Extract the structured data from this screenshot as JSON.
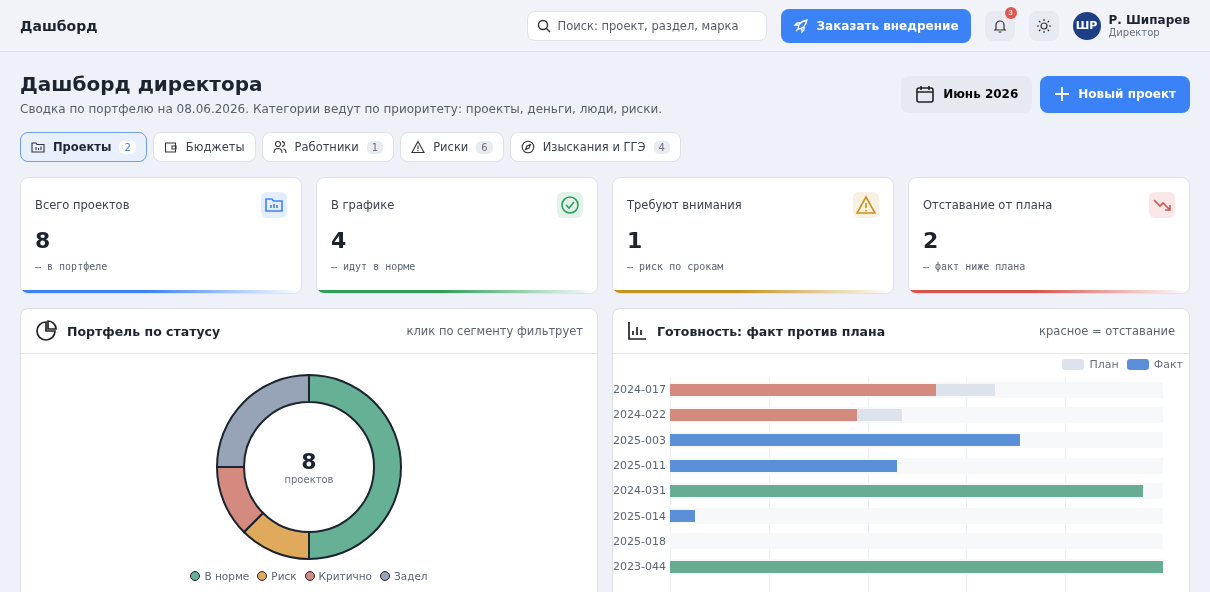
{
  "header": {
    "title": "Дашборд",
    "search": {
      "placeholder": "Поиск: проект, раздел, марка"
    },
    "order_button": "Заказать внедрение",
    "notifications": {
      "count": "3"
    },
    "user": {
      "initials": "ШР",
      "name": "Р. Шипарев",
      "role": "Директор"
    }
  },
  "page": {
    "title": "Дашборд директора",
    "subtitle": "Сводка по портфелю на 08.06.2026. Категории ведут по приоритету: проекты, деньги, люди, риски.",
    "period_button": "Июнь 2026",
    "new_button": "Новый проект"
  },
  "tabs": [
    {
      "kind": "folder",
      "label": "Проекты",
      "count": "2",
      "selected": true
    },
    {
      "kind": "wallet",
      "label": "Бюджеты",
      "selected": false
    },
    {
      "kind": "people",
      "label": "Работники",
      "count": "1",
      "selected": false
    },
    {
      "kind": "warning",
      "label": "Риски",
      "count": "6",
      "selected": false
    },
    {
      "kind": "compass",
      "label": "Изыскания и ГГЭ",
      "count": "4",
      "selected": false
    }
  ],
  "stats": [
    {
      "kind": "folder",
      "title": "Всего проектов",
      "value": "8",
      "note": "— в портфеле",
      "color": "#3b82f6"
    },
    {
      "kind": "check",
      "title": "В графике",
      "value": "4",
      "note": "— идут в норме",
      "color": "#2f9e5b"
    },
    {
      "kind": "warning",
      "title": "Требуют внимания",
      "value": "1",
      "note": "— риск по срокам",
      "color": "#c8921e"
    },
    {
      "kind": "trend",
      "title": "Отставание от плана",
      "value": "2",
      "note": "— факт ниже плана",
      "color": "#d9534f"
    }
  ],
  "status_panel": {
    "title": "Портфель по статусу",
    "hint": "клик по сегменту фильтрует",
    "center_value": "8",
    "center_label": "проектов",
    "chart_data": {
      "type": "donut",
      "categories": [
        "В норме",
        "Риск",
        "Критично",
        "Задел"
      ],
      "values": [
        50,
        12.5,
        12.5,
        25
      ],
      "colors": [
        "#66b096",
        "#e0aa5c",
        "#d58a80",
        "#97a4b8"
      ],
      "legend": "bottom"
    }
  },
  "progress_panel": {
    "title": "Готовность: факт против плана",
    "hint": "красное = отставание",
    "legend": [
      {
        "label": "План",
        "color": "#dde3ec"
      },
      {
        "label": "Факт",
        "color": "#5b8fd8"
      }
    ],
    "rows": [
      {
        "label": "2024-017",
        "plan": {
          "level": 0.66
        },
        "fact": {
          "level": 0.54
        },
        "color": "#d58a80"
      },
      {
        "label": "2024-022",
        "plan": {
          "level": 0.47
        },
        "fact": {
          "level": 0.38
        },
        "color": "#d58a80"
      },
      {
        "label": "2025-003",
        "fact": {
          "level": 0.71
        },
        "color": "#5b8fd8"
      },
      {
        "label": "2025-011",
        "fact": {
          "level": 0.46
        },
        "color": "#5b8fd8"
      },
      {
        "label": "2024-031",
        "fact": {
          "level": 0.96
        },
        "color": "#66ad93"
      },
      {
        "label": "2025-014",
        "fact": {
          "level": 0.05
        },
        "color": "#5b8fd8"
      },
      {
        "label": "2025-018"
      },
      {
        "label": "2023-044",
        "fact": {
          "level": 1
        },
        "color": "#66ad93"
      }
    ]
  }
}
